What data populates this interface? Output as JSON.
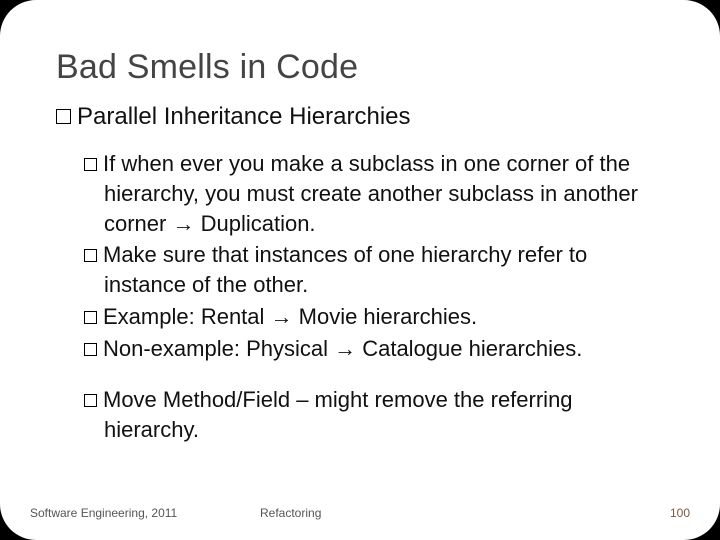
{
  "slide": {
    "title": "Bad Smells in Code",
    "heading": "Parallel Inheritance Hierarchies",
    "points": {
      "p1": "If when ever you make a subclass in one corner of the hierarchy, you must create another subclass in another corner → Duplication.",
      "p2": "Make sure that instances of one hierarchy refer to instance of the other.",
      "p3": "Example: Rental → Movie hierarchies.",
      "p4": "Non-example: Physical → Catalogue hierarchies.",
      "p5": "Move Method/Field – might remove the referring hierarchy."
    }
  },
  "footer": {
    "left": "Software Engineering, 2011",
    "center": "Refactoring",
    "page": "100"
  }
}
